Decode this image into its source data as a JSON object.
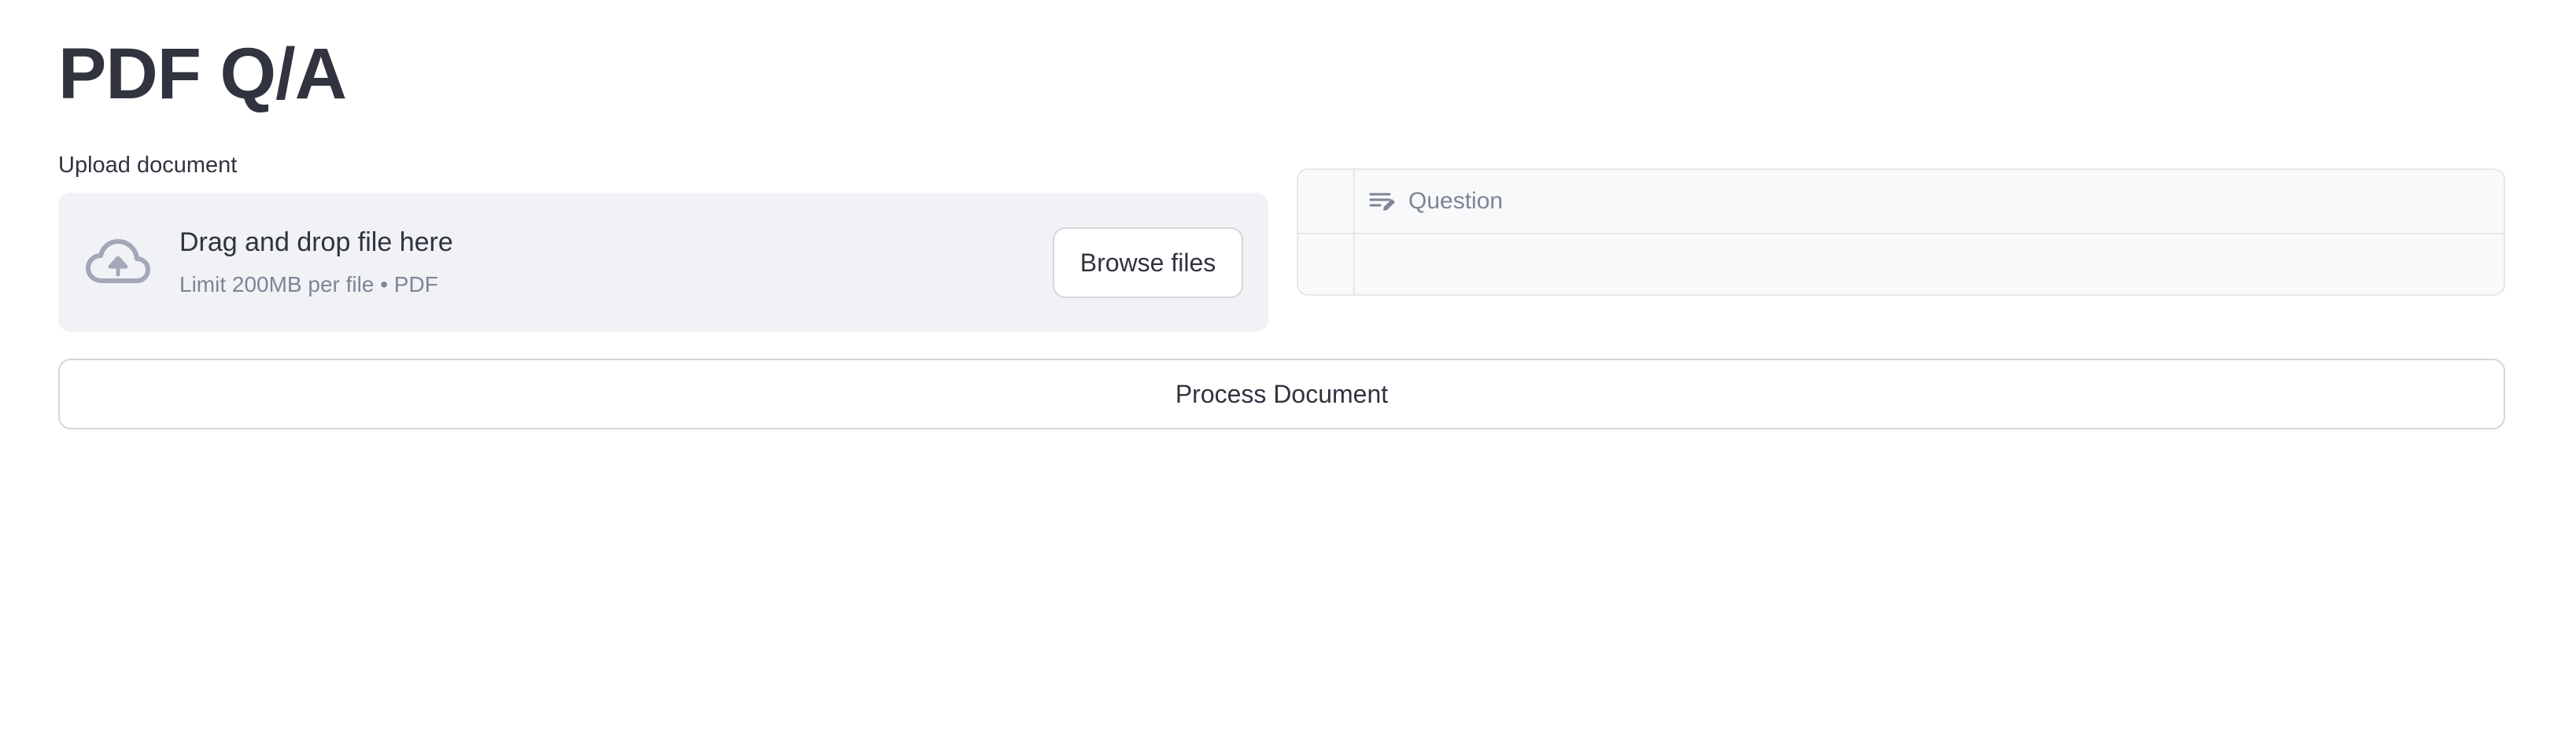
{
  "page": {
    "title": "PDF Q/A"
  },
  "uploader": {
    "label": "Upload document",
    "drop_text": "Drag and drop file here",
    "limit_text": "Limit 200MB per file • PDF",
    "browse_label": "Browse files",
    "icon": "cloud-upload-icon"
  },
  "table": {
    "columns": [
      {
        "label": "Question",
        "icon": "text-edit-icon"
      }
    ],
    "rows": [
      {
        "Question": ""
      }
    ]
  },
  "actions": {
    "process_label": "Process Document"
  },
  "colors": {
    "text": "#31333f",
    "muted": "#808495",
    "dropzone_bg": "#f0f2f6",
    "border": "#d6d6d9",
    "icon": "#a3a8b8"
  }
}
